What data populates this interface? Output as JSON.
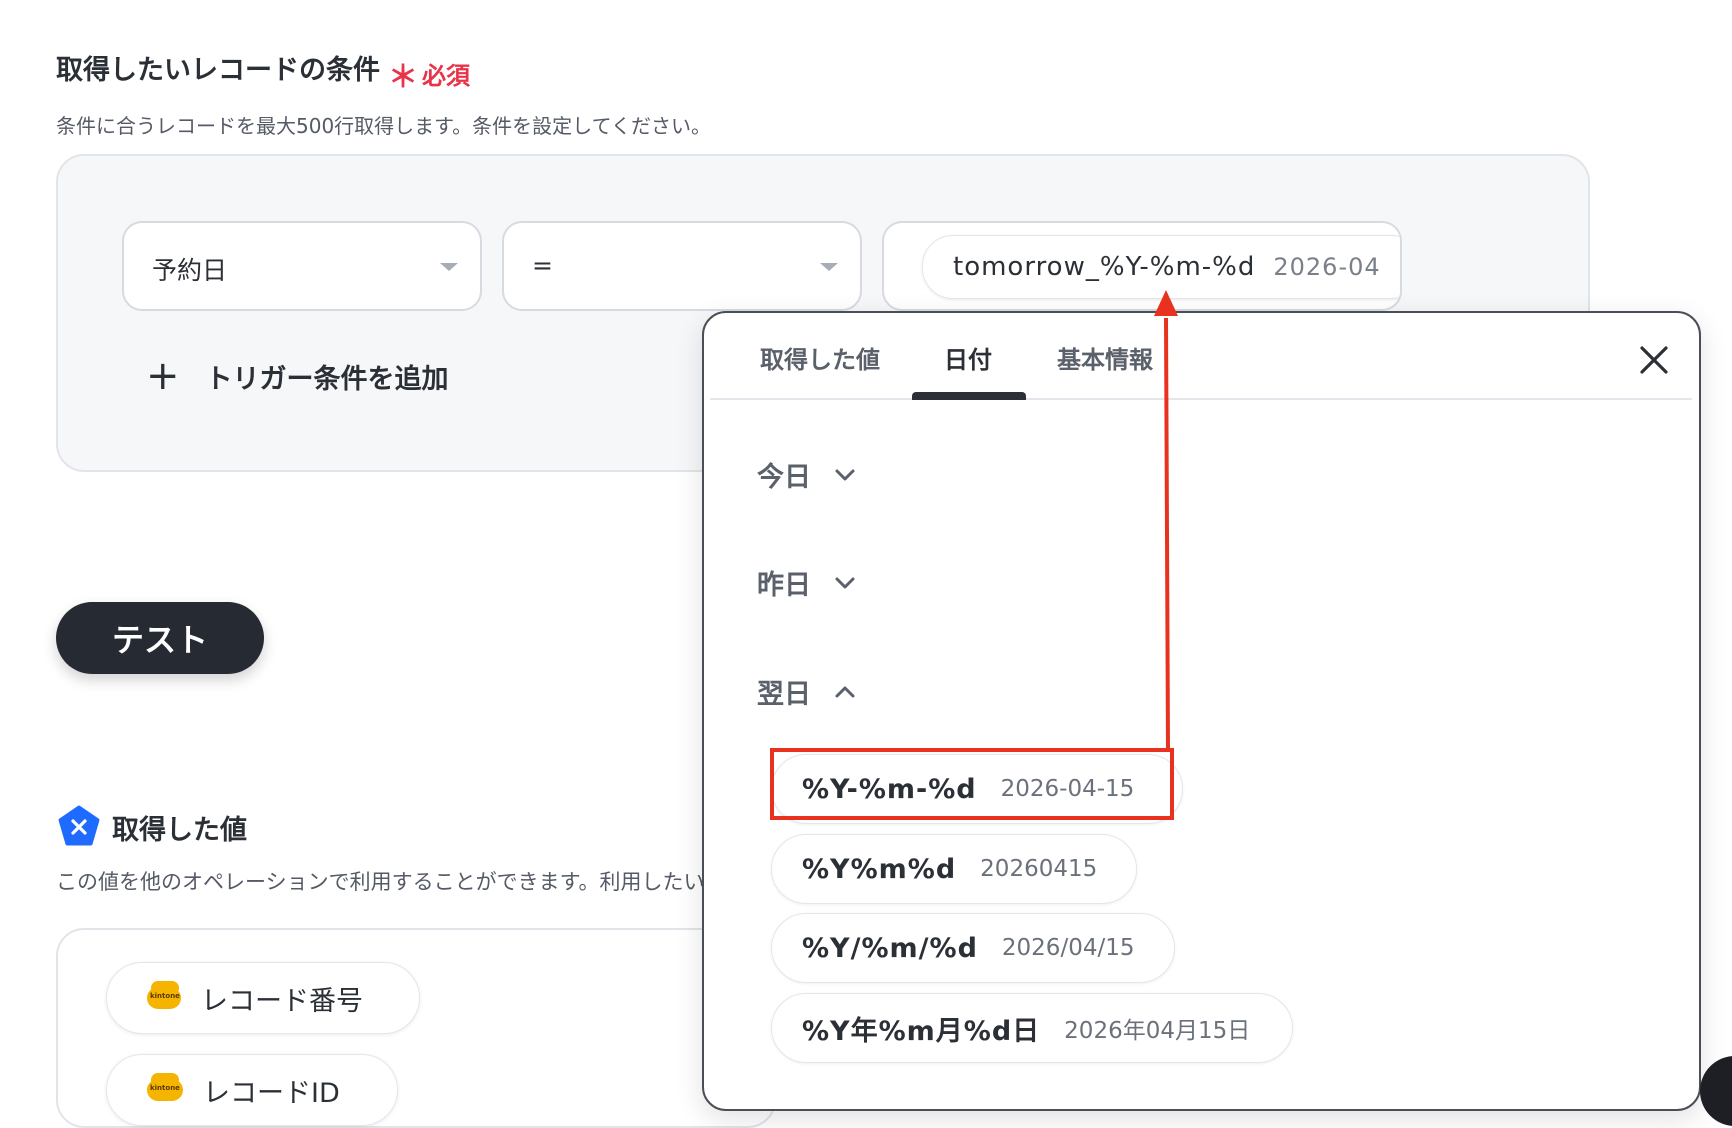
{
  "section1": {
    "title": "取得したいレコードの条件",
    "required_mark": "＊",
    "required_label": "必須",
    "description": "条件に合うレコードを最大500行取得します。条件を設定してください。"
  },
  "condition": {
    "field_value": "予約日",
    "operator_value": "=",
    "value_format": "tomorrow_%Y-%m-%d",
    "value_sample": "2026-04",
    "add_trigger_label": "トリガー条件を追加"
  },
  "test_button": "テスト",
  "section2": {
    "title": "取得した値",
    "description": "この値を他のオペレーションで利用することができます。利用したい",
    "items": [
      {
        "label": "レコード番号"
      },
      {
        "label": "レコードID"
      }
    ]
  },
  "panel": {
    "tabs": [
      "取得した値",
      "日付",
      "基本情報"
    ],
    "active_tab": "日付",
    "groups": [
      {
        "label": "今日",
        "state": "collapsed"
      },
      {
        "label": "昨日",
        "state": "collapsed"
      },
      {
        "label": "翌日",
        "state": "expanded"
      }
    ],
    "options": [
      {
        "format": "%Y-%m-%d",
        "sample": "2026-04-15"
      },
      {
        "format": "%Y%m%d",
        "sample": "20260415"
      },
      {
        "format": "%Y/%m/%d",
        "sample": "2026/04/15"
      },
      {
        "format": "%Y年%m月%d日",
        "sample": "2026年04月15日"
      }
    ]
  },
  "icons": {
    "plus": "plus-icon",
    "caret": "caret-down-icon",
    "close": "close-icon",
    "chevron_down": "chevron-down-icon",
    "chevron_up": "chevron-up-icon",
    "section2_icon": "x-pentagon-icon",
    "kintone_icon": "kintone-icon"
  },
  "colors": {
    "accent_required": "#e8334a",
    "annotation_red": "#e8321f",
    "dark_button": "#262a33",
    "brand_blue": "#1f6bff",
    "kintone_yellow": "#f5b400"
  },
  "kintone_icon_text": "kintone"
}
